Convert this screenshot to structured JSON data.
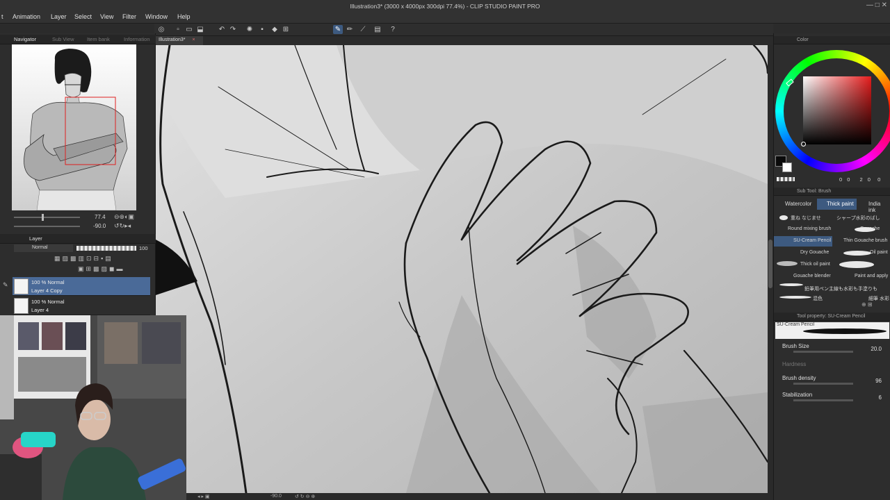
{
  "window": {
    "title": "Illustration3* (3000 x 4000px 300dpi 77.4%) - CLIP STUDIO PAINT PRO",
    "controls": "— □ ✕"
  },
  "menu": [
    "Animation",
    "Layer",
    "Select",
    "View",
    "Filter",
    "Window",
    "Help"
  ],
  "menu_prefix": "t",
  "left": {
    "tabs": [
      "Navigator",
      "Sub View",
      "Item bank",
      "Information"
    ],
    "zoom_value": "77.4",
    "rotate_value": "-90.0",
    "layer_tab": "Layer",
    "blend_mode": "Normal",
    "opacity": "100",
    "layers": [
      {
        "mode": "100 % Normal",
        "name": "Layer 4 Copy",
        "selected": true
      },
      {
        "mode": "100 % Normal",
        "name": "Layer 4",
        "selected": false
      }
    ]
  },
  "document_tab": "Illustration3*",
  "status": {
    "rotation": "-90.0"
  },
  "right": {
    "color_tab": "Color",
    "color_values": [
      "0",
      "0",
      "2",
      "0",
      "0"
    ],
    "subtool_header": "Sub Tool: Brush",
    "subtool_tabs": [
      "Watercolor",
      "Thick paint",
      "India ink"
    ],
    "brushes_left": [
      "重ね なじませ",
      "Round mixing brush",
      "SU-Cream Pencil",
      "Dry Gouache",
      "Thick oil paint",
      "Gouache blender",
      "",
      "混色"
    ],
    "brushes_right": [
      "シャープ水彩のばし",
      "Gouache",
      "Thin Gouache brush",
      "Oil paint",
      "",
      "Paint and apply",
      "鉛筆用ペン主線も水彩も手塗りも",
      "細筆 水彩"
    ],
    "tool_property_header": "Tool property: SU-Cream Pencil",
    "current_brush": "SU-Cream Pencil",
    "properties": [
      {
        "label": "Brush Size",
        "value": "20.0"
      },
      {
        "label": "Hardness",
        "value": ""
      },
      {
        "label": "Brush density",
        "value": "96"
      },
      {
        "label": "Stabilization",
        "value": "6"
      }
    ]
  },
  "colors": {
    "accent": "#3d5a80",
    "main_color": "#0a0a0a",
    "sub_color": "#ffffff"
  }
}
